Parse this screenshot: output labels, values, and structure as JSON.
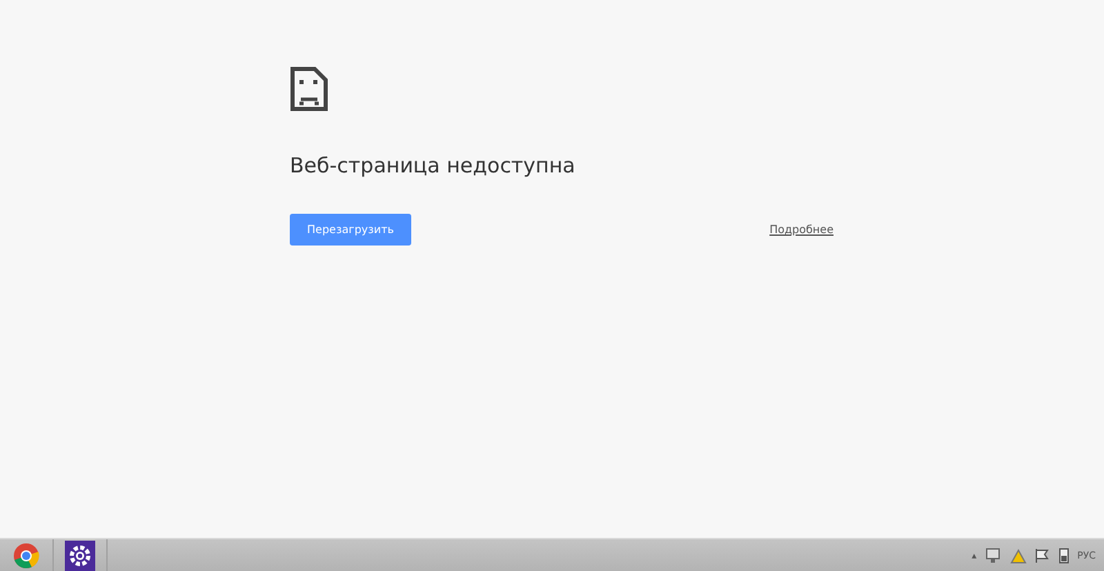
{
  "error_page": {
    "title": "Веб-страница недоступна",
    "reload_button": "Перезагрузить",
    "details_link": "Подробнее"
  },
  "taskbar": {
    "tray_arrow": "▴",
    "language": "РУС"
  }
}
